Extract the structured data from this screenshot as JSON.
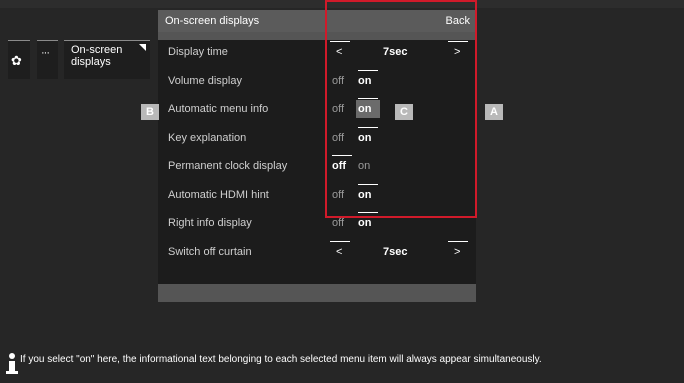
{
  "nav": {
    "settings_icon": "gear-icon",
    "more_label": "···",
    "osd_label": "On-screen displays"
  },
  "panel": {
    "title": "On-screen displays",
    "back_label": "Back",
    "rows": [
      {
        "label": "Display time",
        "type": "value",
        "left": "<",
        "value": "7sec",
        "right": ">"
      },
      {
        "label": "Volume display",
        "type": "toggle",
        "off": "off",
        "on": "on",
        "selected": "on"
      },
      {
        "label": "Automatic menu info",
        "type": "toggle",
        "off": "off",
        "on": "on",
        "selected": "on"
      },
      {
        "label": "Key explanation",
        "type": "toggle",
        "off": "off",
        "on": "on",
        "selected": "on"
      },
      {
        "label": "Permanent clock display",
        "type": "toggle",
        "off": "off",
        "on": "on",
        "selected": "off"
      },
      {
        "label": "Automatic HDMI hint",
        "type": "toggle",
        "off": "off",
        "on": "on",
        "selected": "on"
      },
      {
        "label": "Right info display",
        "type": "toggle",
        "off": "off",
        "on": "on",
        "selected": "on"
      },
      {
        "label": "Switch off curtain",
        "type": "value",
        "left": "<",
        "value": "7sec",
        "right": ">"
      }
    ]
  },
  "markers": {
    "a": "A",
    "b": "B",
    "c": "C"
  },
  "footer": {
    "info_text": "If you select \"on\" here, the informational text belonging to each selected menu item will always appear simultaneously."
  }
}
